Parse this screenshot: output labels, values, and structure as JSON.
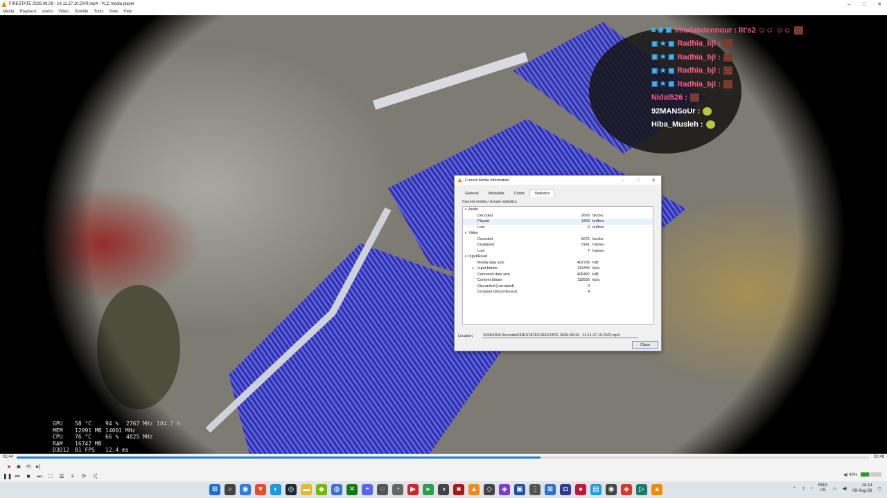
{
  "window": {
    "title": "FIRESTATE 2026.08.09 - 14.11.27.10.DVR.mp4 - VLC media player",
    "controls": [
      "–",
      "□",
      "✕"
    ]
  },
  "menu": [
    "Media",
    "Playback",
    "Audio",
    "Video",
    "Subtitle",
    "Tools",
    "View",
    "Help"
  ],
  "chat": [
    {
      "user": "Imadabdennour",
      "badges": "◙ ◉ ▣",
      "color": "#ff5c8a",
      "suffix": ": lit's2 ☺☺ ☺☺"
    },
    {
      "user": "Radhia_bjl",
      "badges": "▣ ★ ▣",
      "color": "#ff5c8a",
      "suffix": ":"
    },
    {
      "user": "Radhia_bjl",
      "badges": "▣ ★ ▣",
      "color": "#ff5c8a",
      "suffix": ":"
    },
    {
      "user": "Radhia_bjl",
      "badges": "▣ ★ ▣",
      "color": "#ff5c8a",
      "suffix": ":"
    },
    {
      "user": "Radhia_bjl",
      "badges": "▣ ★ ▣",
      "color": "#ff5c8a",
      "suffix": ":"
    },
    {
      "user": "Nidal526",
      "badges": "",
      "color": "#ff5c8a",
      "suffix": ":"
    },
    {
      "user": "92MANSoUr",
      "badges": "",
      "color": "#ffffff",
      "suffix": ":"
    },
    {
      "user": "Hiba_Musleh",
      "badges": "",
      "color": "#ffffff",
      "suffix": ":"
    }
  ],
  "osd": [
    {
      "k": "GPU",
      "a": "58 °C",
      "b": "94 %",
      "c": "2767 MHz",
      "d": "184.7 W"
    },
    {
      "k": "MEM",
      "a": "12091 MB",
      "b": "14001 MHz",
      "c": "",
      "d": ""
    },
    {
      "k": "CPU",
      "a": "76 °C",
      "b": "66 %",
      "c": "4825 MHz",
      "d": ""
    },
    {
      "k": "RAM",
      "a": "16742 MB",
      "b": "",
      "c": "",
      "d": ""
    },
    {
      "k": "D3D12",
      "a": "81 FPS",
      "b": "12.4 ms",
      "c": "",
      "d": ""
    }
  ],
  "dialog": {
    "title": "Current Media Information",
    "tabs": [
      "General",
      "Metadata",
      "Codec",
      "Statistics"
    ],
    "active_tab": "Statistics",
    "caption": "Current media / stream statistics",
    "rows": [
      {
        "type": "group",
        "label": "Audio"
      },
      {
        "type": "item",
        "label": "Decoded",
        "value": "2665",
        "unit": "blocks"
      },
      {
        "type": "item",
        "label": "Played",
        "value": "1300",
        "unit": "buffers",
        "hl": true
      },
      {
        "type": "item",
        "label": "Lost",
        "value": "0",
        "unit": "buffers"
      },
      {
        "type": "group",
        "label": "Video"
      },
      {
        "type": "item",
        "label": "Decoded",
        "value": "6675",
        "unit": "blocks"
      },
      {
        "type": "item",
        "label": "Displayed",
        "value": "3141",
        "unit": "frames"
      },
      {
        "type": "item",
        "label": "Lost",
        "value": "7",
        "unit": "frames"
      },
      {
        "type": "group",
        "label": "Input/Read"
      },
      {
        "type": "item",
        "label": "Media data size",
        "value": "402736",
        "unit": "KiB"
      },
      {
        "type": "sub",
        "label": "Input bitrate",
        "value": "119444",
        "unit": "kb/s"
      },
      {
        "type": "item",
        "label": "Demuxed data size",
        "value": "406482",
        "unit": "KiB"
      },
      {
        "type": "item",
        "label": "Content bitrate",
        "value": "118556",
        "unit": "kb/s"
      },
      {
        "type": "item",
        "label": "Discarded (corrupted)",
        "value": "0",
        "unit": ""
      },
      {
        "type": "item",
        "label": "Dropped (discontinued)",
        "value": "4",
        "unit": ""
      }
    ],
    "location_label": "Location:",
    "location_value": "D:\\NVIDIA Records\\FIRESTATE\\FIRESTATE 2026.08.09 - 14.11.27.10.DVR.mp4",
    "close_label": "Close"
  },
  "player": {
    "time_elapsed": "01:44",
    "time_total": "02:49",
    "progress": 0.615,
    "volume_label": "40%"
  },
  "taskbar": {
    "icons": [
      {
        "name": "start-icon",
        "glyph": "⊞",
        "color": "#1d6fd1"
      },
      {
        "name": "search-icon",
        "glyph": "⌕",
        "color": "#444"
      },
      {
        "name": "chrome-icon",
        "glyph": "◉",
        "color": "#2a7de1"
      },
      {
        "name": "brave-icon",
        "glyph": "▼",
        "color": "#e2502a"
      },
      {
        "name": "edge-icon",
        "glyph": "◐",
        "color": "#1a9ad6"
      },
      {
        "name": "steam-icon",
        "glyph": "◎",
        "color": "#1b2838"
      },
      {
        "name": "explorer-icon",
        "glyph": "▬",
        "color": "#e8b630"
      },
      {
        "name": "nvidia-icon",
        "glyph": "◆",
        "color": "#76b900"
      },
      {
        "name": "app-icon-1",
        "glyph": "◍",
        "color": "#3b6fd1"
      },
      {
        "name": "xbox-icon",
        "glyph": "✕",
        "color": "#107c10"
      },
      {
        "name": "discord-icon",
        "glyph": "◓",
        "color": "#5865f2"
      },
      {
        "name": "app-icon-2",
        "glyph": "◌",
        "color": "#555"
      },
      {
        "name": "app-icon-3",
        "glyph": "◔",
        "color": "#666"
      },
      {
        "name": "app-icon-4",
        "glyph": "▶",
        "color": "#c52b2b"
      },
      {
        "name": "app-icon-5",
        "glyph": "▸",
        "color": "#2e9d47"
      },
      {
        "name": "app-icon-6",
        "glyph": "◑",
        "color": "#444"
      },
      {
        "name": "app-icon-7",
        "glyph": "■",
        "color": "#a81818"
      },
      {
        "name": "app-icon-8",
        "glyph": "▲",
        "color": "#f28a1c"
      },
      {
        "name": "app-icon-9",
        "glyph": "◇",
        "color": "#444"
      },
      {
        "name": "app-icon-10",
        "glyph": "◈",
        "color": "#7a3fc9"
      },
      {
        "name": "app-icon-11",
        "glyph": "▣",
        "color": "#1e4fa1"
      },
      {
        "name": "app-icon-12",
        "glyph": "⋮",
        "color": "#555"
      },
      {
        "name": "app-icon-13",
        "glyph": "⊠",
        "color": "#2a6fd1"
      },
      {
        "name": "app-icon-14",
        "glyph": "◘",
        "color": "#2e3d8c"
      },
      {
        "name": "app-icon-15",
        "glyph": "●",
        "color": "#c0163a"
      },
      {
        "name": "app-icon-16",
        "glyph": "▤",
        "color": "#1aa1d6"
      },
      {
        "name": "app-icon-17",
        "glyph": "◉",
        "color": "#444"
      },
      {
        "name": "app-icon-18",
        "glyph": "◈",
        "color": "#d13b2f"
      },
      {
        "name": "app-icon-19",
        "glyph": "▷",
        "color": "#1a7d6b"
      },
      {
        "name": "vlc-icon",
        "glyph": "▲",
        "color": "#f08a00"
      }
    ],
    "lang_top": "ENG",
    "lang_bottom": "US",
    "time": "14:14",
    "date": "09-Aug-26"
  }
}
